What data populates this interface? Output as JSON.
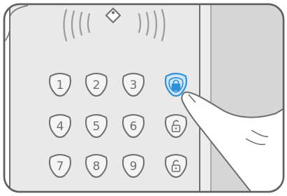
{
  "keypad": {
    "keys": [
      {
        "label": "1",
        "type": "digit"
      },
      {
        "label": "2",
        "type": "digit"
      },
      {
        "label": "3",
        "type": "digit"
      },
      {
        "label": "",
        "type": "lock",
        "icon": "locked-padlock-icon",
        "state": "highlighted"
      },
      {
        "label": "4",
        "type": "digit"
      },
      {
        "label": "5",
        "type": "digit"
      },
      {
        "label": "6",
        "type": "digit"
      },
      {
        "label": "",
        "type": "lock",
        "icon": "unlocked-padlock-icon",
        "state": "normal"
      },
      {
        "label": "7",
        "type": "digit"
      },
      {
        "label": "8",
        "type": "digit"
      },
      {
        "label": "9",
        "type": "digit"
      },
      {
        "label": "",
        "type": "lock",
        "icon": "unlocked-padlock-icon",
        "state": "normal"
      }
    ]
  },
  "rfid_reader": {
    "icon": "rfid-tag-icon"
  },
  "colors": {
    "line": "#6e6e6e",
    "panel": "#e8e8e8",
    "wall": "#d9d9d9",
    "highlight": "#2f8fd8",
    "highlight_fill": "#cfe6f8"
  }
}
